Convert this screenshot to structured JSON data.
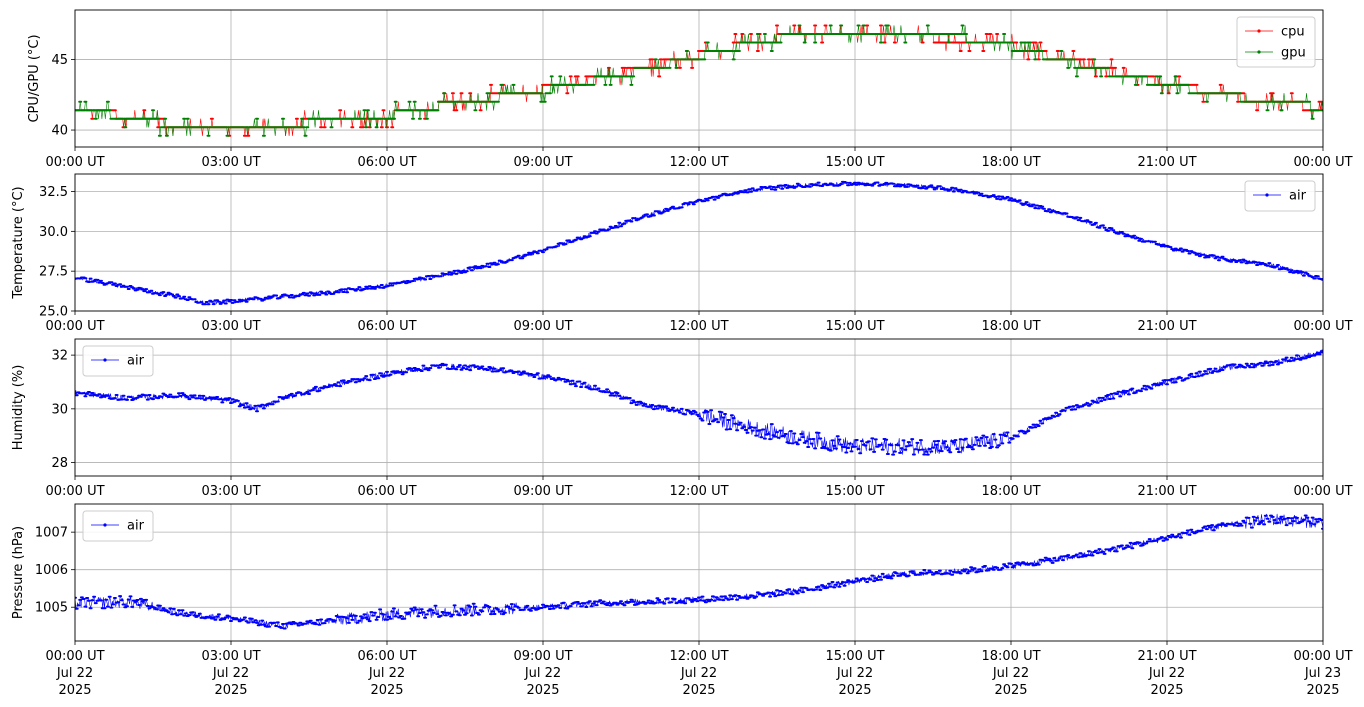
{
  "chart_data": [
    {
      "type": "line",
      "ylabel": "CPU/GPU (°C)",
      "xlabel": "",
      "ylim": [
        38.8,
        48.5
      ],
      "yticks": [
        40,
        45
      ],
      "ytick_labels": [
        "40",
        "45"
      ],
      "x_range_hours": [
        0,
        24
      ],
      "xtick_labels": [
        "00:00 UT",
        "03:00 UT",
        "06:00 UT",
        "09:00 UT",
        "12:00 UT",
        "15:00 UT",
        "18:00 UT",
        "21:00 UT",
        "00:00 UT"
      ],
      "grid": true,
      "legend": "upper right",
      "series": [
        {
          "name": "cpu",
          "color": "#ff0000",
          "x": [
            0,
            1,
            2,
            3,
            4,
            5,
            6,
            7,
            8,
            9,
            10,
            11,
            12,
            13,
            14,
            15,
            16,
            17,
            18,
            19,
            20,
            21,
            22,
            23,
            24
          ],
          "values": [
            41.4,
            41.0,
            40.3,
            40.0,
            40.3,
            40.8,
            41.0,
            41.7,
            42.3,
            42.9,
            43.6,
            44.4,
            45.3,
            46.2,
            46.8,
            47.0,
            46.7,
            46.3,
            46.0,
            45.0,
            44.1,
            43.3,
            42.6,
            42.0,
            41.5
          ]
        },
        {
          "name": "gpu",
          "color": "#008000",
          "x": [
            0,
            1,
            2,
            3,
            4,
            5,
            6,
            7,
            8,
            9,
            10,
            11,
            12,
            13,
            14,
            15,
            16,
            17,
            18,
            19,
            20,
            21,
            22,
            23,
            24
          ],
          "values": [
            41.3,
            41.0,
            40.2,
            40.0,
            40.2,
            40.8,
            41.0,
            41.7,
            42.2,
            42.8,
            43.5,
            44.3,
            45.2,
            46.1,
            46.8,
            47.0,
            46.8,
            46.6,
            45.9,
            44.9,
            44.0,
            43.2,
            42.5,
            42.0,
            41.6
          ]
        }
      ]
    },
    {
      "type": "line",
      "ylabel": "Temperature (°C)",
      "xlabel": "",
      "ylim": [
        25.0,
        33.6
      ],
      "yticks": [
        25.0,
        27.5,
        30.0,
        32.5
      ],
      "ytick_labels": [
        "25.0",
        "27.5",
        "30.0",
        "32.5"
      ],
      "x_range_hours": [
        0,
        24
      ],
      "xtick_labels": [
        "00:00 UT",
        "03:00 UT",
        "06:00 UT",
        "09:00 UT",
        "12:00 UT",
        "15:00 UT",
        "18:00 UT",
        "21:00 UT",
        "00:00 UT"
      ],
      "grid": true,
      "legend": "upper right",
      "series": [
        {
          "name": "air",
          "color": "#0000ff",
          "x": [
            0,
            1,
            2,
            2.5,
            3,
            4,
            5,
            6,
            7,
            8,
            9,
            10,
            11,
            12,
            13,
            14,
            15,
            16,
            17,
            18,
            19,
            20,
            21,
            22,
            23,
            24
          ],
          "values": [
            27.1,
            26.5,
            25.9,
            25.5,
            25.6,
            25.9,
            26.2,
            26.6,
            27.2,
            27.9,
            28.8,
            29.9,
            31.0,
            31.9,
            32.6,
            32.9,
            33.0,
            32.9,
            32.6,
            32.0,
            31.1,
            30.0,
            29.0,
            28.3,
            27.9,
            27.0
          ]
        }
      ]
    },
    {
      "type": "line",
      "ylabel": "Humidity (%)",
      "xlabel": "",
      "ylim": [
        27.5,
        32.6
      ],
      "yticks": [
        28,
        30,
        32
      ],
      "ytick_labels": [
        "28",
        "30",
        "32"
      ],
      "x_range_hours": [
        0,
        24
      ],
      "xtick_labels": [
        "00:00 UT",
        "03:00 UT",
        "06:00 UT",
        "09:00 UT",
        "12:00 UT",
        "15:00 UT",
        "18:00 UT",
        "21:00 UT",
        "00:00 UT"
      ],
      "grid": true,
      "legend": "upper left",
      "series": [
        {
          "name": "air",
          "color": "#0000ff",
          "x": [
            0,
            1,
            2,
            3,
            3.5,
            4,
            5,
            6,
            7,
            8,
            9,
            10,
            11,
            12,
            13,
            14,
            15,
            16,
            17,
            18,
            19,
            20,
            21,
            22,
            23,
            24
          ],
          "values": [
            30.6,
            30.4,
            30.5,
            30.3,
            30.0,
            30.4,
            30.9,
            31.3,
            31.6,
            31.5,
            31.2,
            30.8,
            30.1,
            29.8,
            29.3,
            28.9,
            28.6,
            28.6,
            28.6,
            28.9,
            29.9,
            30.5,
            31.0,
            31.5,
            31.7,
            32.1
          ]
        }
      ]
    },
    {
      "type": "line",
      "ylabel": "Pressure (hPa)",
      "xlabel": "",
      "ylim": [
        1004.1,
        1007.75
      ],
      "yticks": [
        1005,
        1006,
        1007
      ],
      "ytick_labels": [
        "1005",
        "1006",
        "1007"
      ],
      "x_range_hours": [
        0,
        24
      ],
      "xtick_labels": [
        "00:00 UT\nJul 22\n2025",
        "03:00 UT\nJul 22\n2025",
        "06:00 UT\nJul 22\n2025",
        "09:00 UT\nJul 22\n2025",
        "12:00 UT\nJul 22\n2025",
        "15:00 UT\nJul 22\n2025",
        "18:00 UT\nJul 22\n2025",
        "21:00 UT\nJul 22\n2025",
        "00:00 UT\nJul 23\n2025"
      ],
      "grid": true,
      "legend": "upper left",
      "series": [
        {
          "name": "air",
          "color": "#0000ff",
          "x": [
            0,
            1,
            2,
            3,
            4,
            5,
            6,
            7,
            8,
            9,
            10,
            11,
            12,
            13,
            14,
            15,
            16,
            17,
            18,
            19,
            20,
            21,
            22,
            23,
            24
          ],
          "values": [
            1005.1,
            1005.15,
            1004.85,
            1004.7,
            1004.5,
            1004.65,
            1004.8,
            1004.9,
            1004.95,
            1005.0,
            1005.1,
            1005.15,
            1005.2,
            1005.3,
            1005.45,
            1005.7,
            1005.9,
            1005.95,
            1006.1,
            1006.3,
            1006.55,
            1006.85,
            1007.15,
            1007.35,
            1007.25
          ]
        }
      ]
    }
  ]
}
